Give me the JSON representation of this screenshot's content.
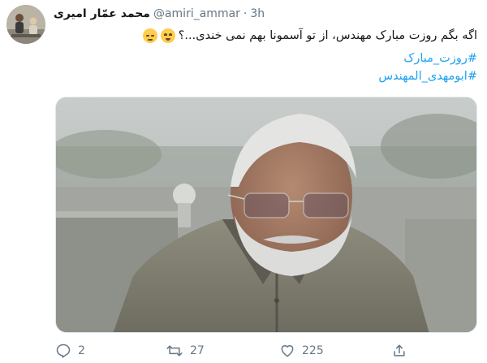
{
  "tweet": {
    "author": {
      "display_name": "محمد عمّار امیری",
      "handle": "@amiri_ammar",
      "separator": "·",
      "time": "3h",
      "avatar_icon": "profile-photo"
    },
    "text": "اگه بگم روزت مبارک مهندس، از تو آسمونا بهم نمی خندی...؟",
    "emojis": [
      "smiling-face-icon",
      "pensive-face-icon"
    ],
    "hashtags": [
      "#روزت_مبارک",
      "#ابومهدی_المهندس"
    ],
    "media": {
      "type": "photo",
      "description_icon": "portrait-photo"
    },
    "actions": {
      "reply_count": "2",
      "retweet_count": "27",
      "like_count": "225"
    },
    "colors": {
      "accent": "#1da1f2",
      "muted": "#657786",
      "text": "#14171a"
    }
  }
}
